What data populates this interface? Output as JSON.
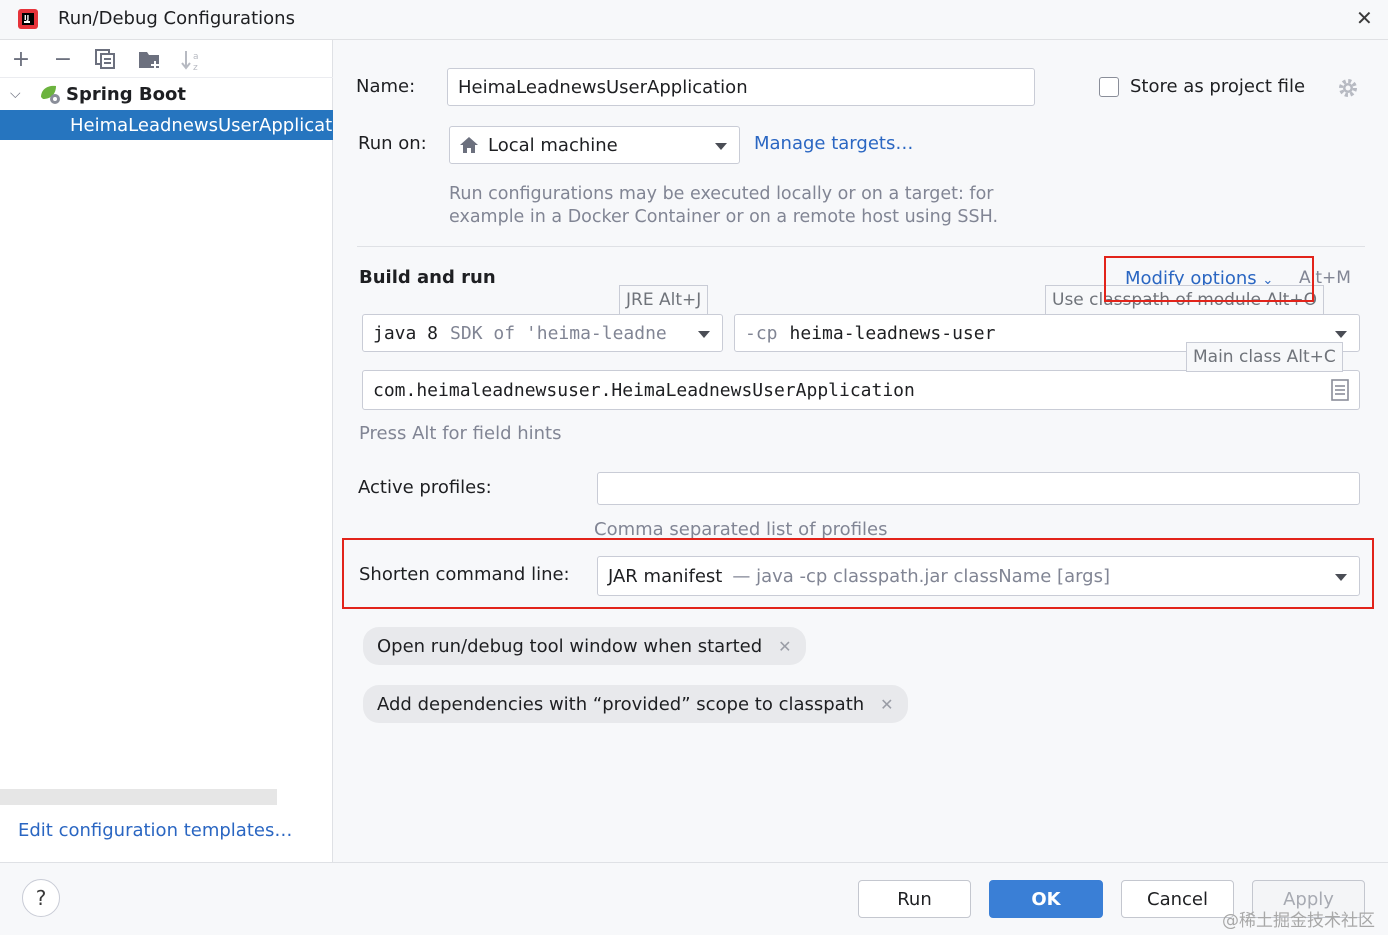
{
  "window": {
    "title": "Run/Debug Configurations"
  },
  "sidebar": {
    "tree": {
      "group_label": "Spring Boot",
      "item_label": "HeimaLeadnewsUserApplication"
    },
    "edit_templates_link": "Edit configuration templates…"
  },
  "form": {
    "name_label": "Name:",
    "name_value": "HeimaLeadnewsUserApplication",
    "store_label": "Store as project file",
    "run_on_label": "Run on:",
    "run_on_value": "Local machine",
    "manage_targets": "Manage targets…",
    "run_on_hint_line1": "Run configurations may be executed locally or on a target: for",
    "run_on_hint_line2": "example in a Docker Container or on a remote host using SSH.",
    "build_run_label": "Build and run",
    "modify_options": "Modify options",
    "modify_options_shortcut": "Alt+M",
    "jre_tooltip": "JRE Alt+J",
    "classpath_tooltip": "Use classpath of module Alt+O",
    "main_class_tooltip": "Main class Alt+C",
    "jre_main": "java 8",
    "jre_secondary": "SDK of 'heima-leadne",
    "cp_prefix": "-cp",
    "cp_value": "heima-leadnews-user",
    "main_class_value": "com.heimaleadnewsuser.HeimaLeadnewsUserApplication",
    "field_hint": "Press Alt for field hints",
    "profiles_label": "Active profiles:",
    "profiles_value": "",
    "profiles_hint": "Comma separated list of profiles",
    "shorten_label": "Shorten command line:",
    "shorten_main": "JAR manifest",
    "shorten_secondary": "— java -cp classpath.jar className [args]",
    "chip1": "Open run/debug tool window when started",
    "chip2": "Add dependencies with “provided” scope to classpath"
  },
  "footer": {
    "help": "?",
    "run": "Run",
    "ok": "OK",
    "cancel": "Cancel",
    "apply": "Apply"
  },
  "watermark": "@稀土掘金技术社区",
  "colors": {
    "accent": "#3a7fd6",
    "selection": "#2675bf",
    "link": "#2a66c2",
    "highlight_box": "#e2231a"
  }
}
